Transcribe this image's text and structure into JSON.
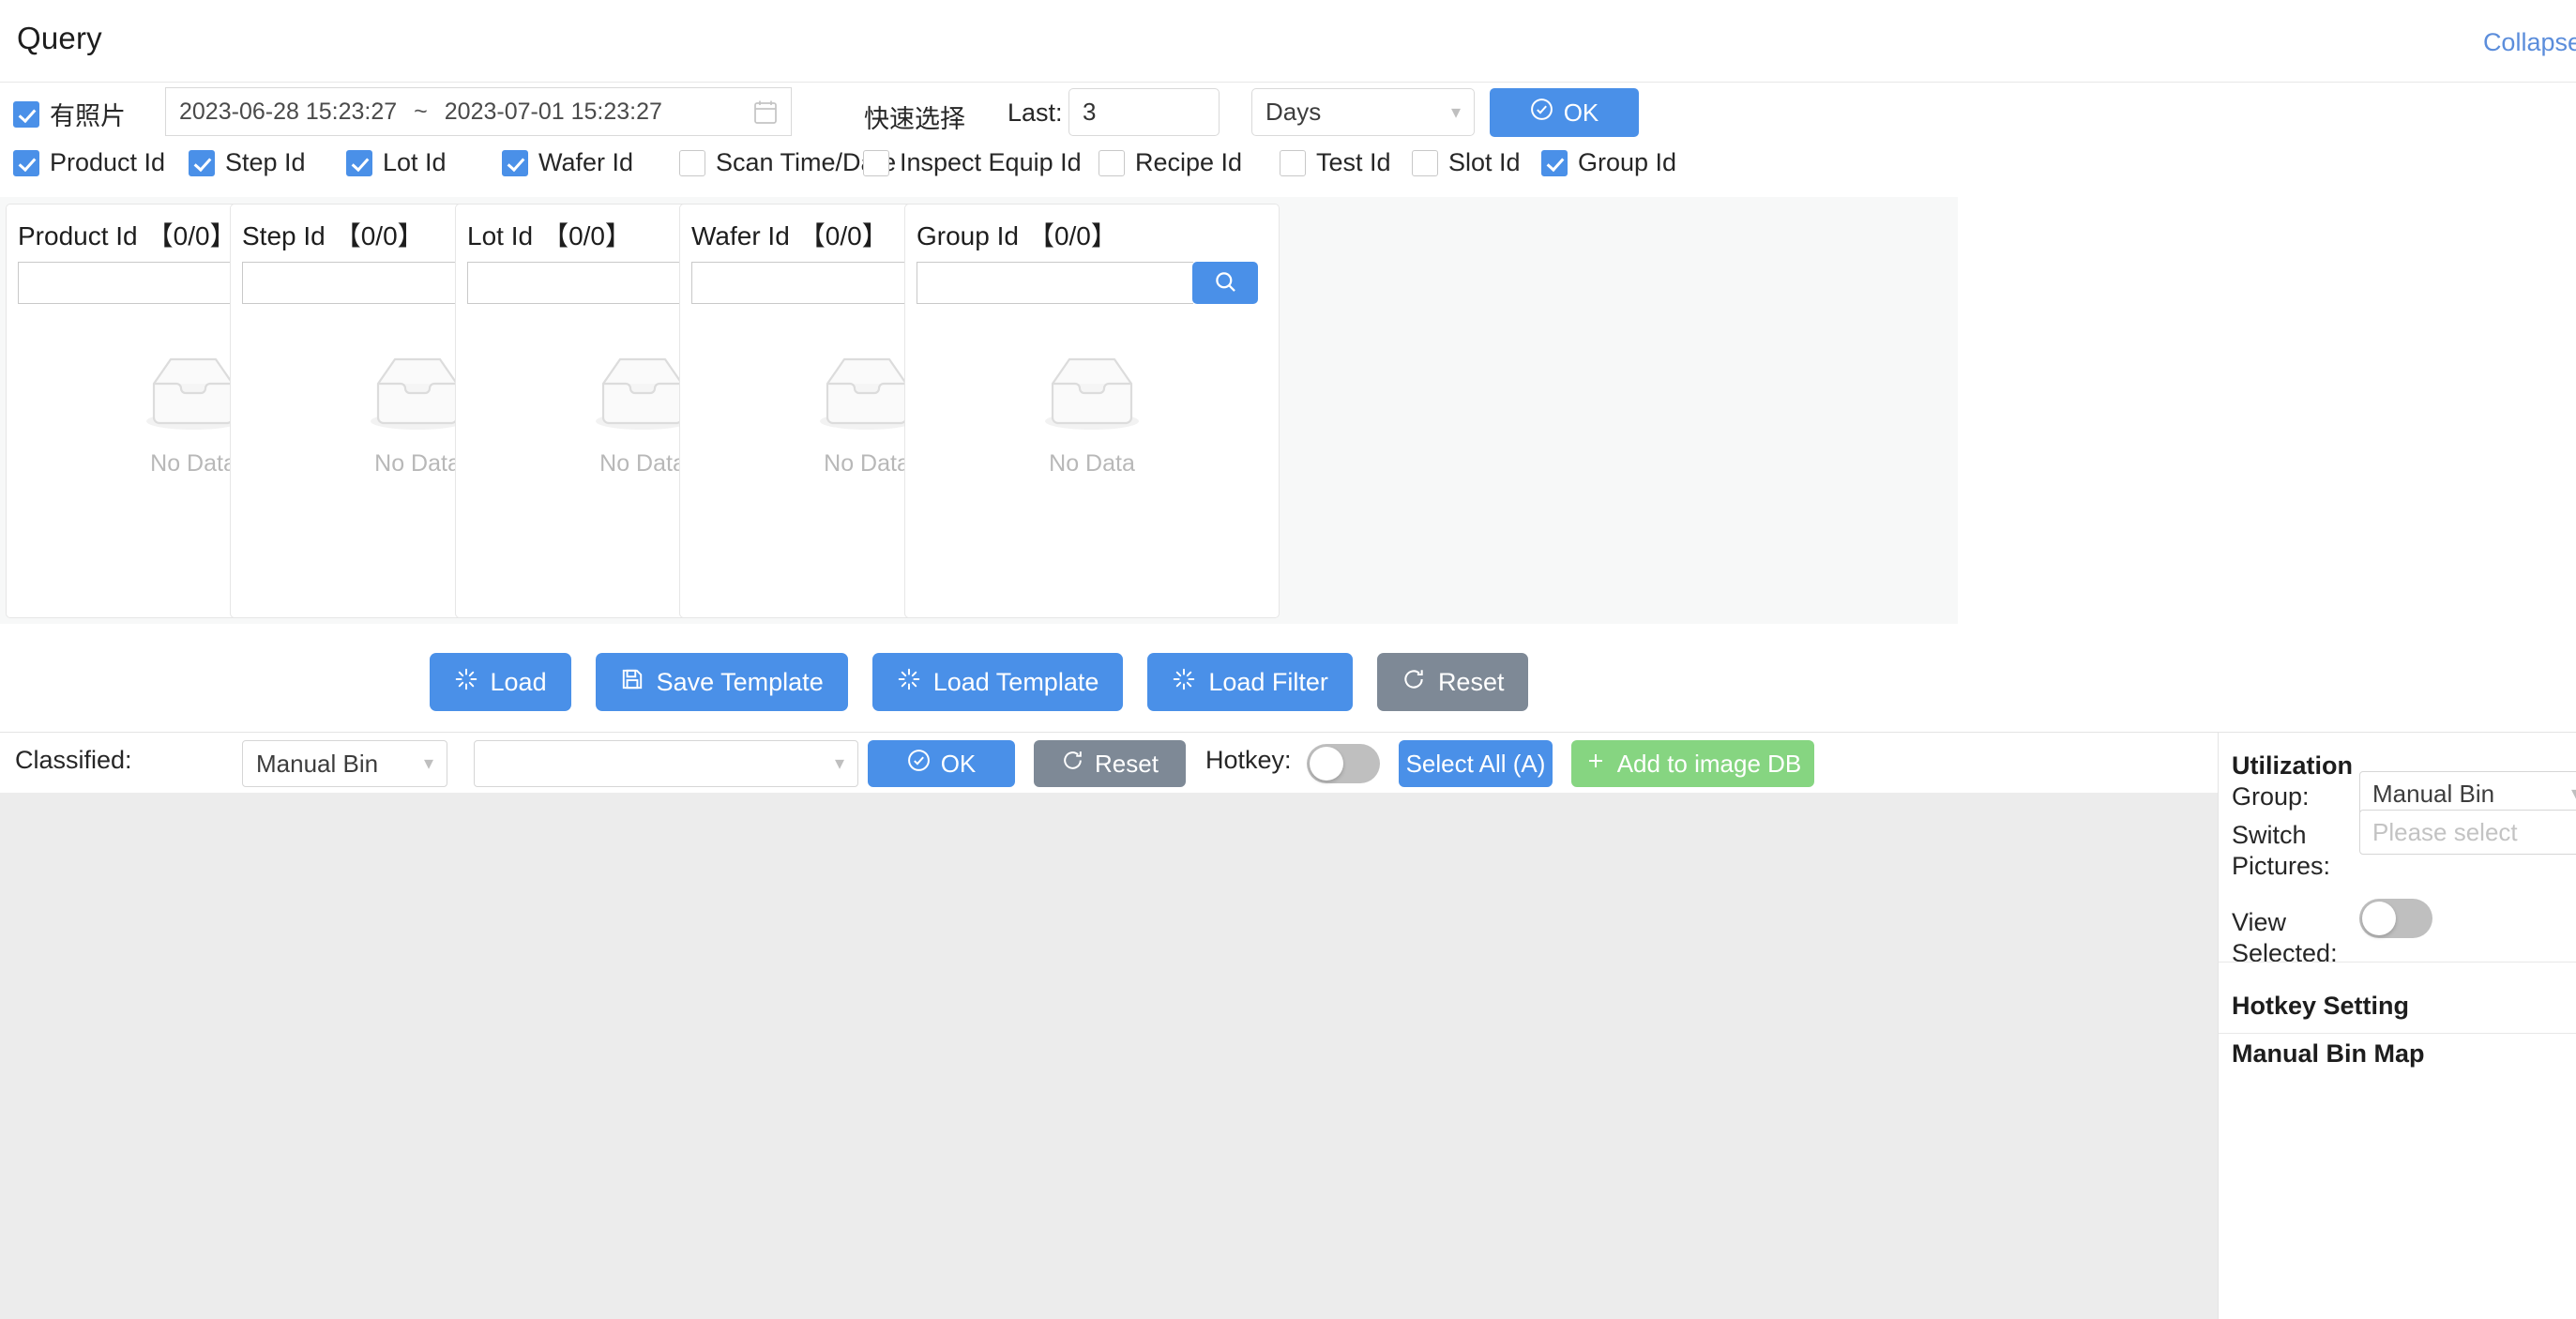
{
  "header": {
    "title": "Query",
    "collapse_label": "Collapse"
  },
  "query": {
    "has_photo": {
      "label": "有照片",
      "checked": true
    },
    "date_range": {
      "start": "2023-06-28 15:23:27",
      "separator": "~",
      "end": "2023-07-01 15:23:27"
    },
    "quick_select_label": "快速选择",
    "last_label": "Last:",
    "last_value": "3",
    "unit_value": "Days",
    "ok_label": "OK",
    "filters": [
      {
        "label": "Product Id",
        "checked": true
      },
      {
        "label": "Step Id",
        "checked": true
      },
      {
        "label": "Lot Id",
        "checked": true
      },
      {
        "label": "Wafer Id",
        "checked": true
      },
      {
        "label": "Scan Time/Date",
        "checked": false
      },
      {
        "label": "Inspect Equip Id",
        "checked": false
      },
      {
        "label": "Recipe Id",
        "checked": false
      },
      {
        "label": "Test Id",
        "checked": false
      },
      {
        "label": "Slot Id",
        "checked": false
      },
      {
        "label": "Group Id",
        "checked": true
      }
    ]
  },
  "cards": [
    {
      "title": "Product Id",
      "count": "【0/0】",
      "search_value": "",
      "empty_text": "No Data"
    },
    {
      "title": "Step Id",
      "count": "【0/0】",
      "search_value": "",
      "empty_text": "No Data"
    },
    {
      "title": "Lot Id",
      "count": "【0/0】",
      "search_value": "",
      "empty_text": "No Data"
    },
    {
      "title": "Wafer Id",
      "count": "【0/0】",
      "search_value": "",
      "empty_text": "No Data"
    },
    {
      "title": "Group Id",
      "count": "【0/0】",
      "search_value": "",
      "empty_text": "No Data"
    }
  ],
  "actions": [
    {
      "label": "Load",
      "icon": "spinner-icon"
    },
    {
      "label": "Save Template",
      "icon": "save-icon"
    },
    {
      "label": "Load Template",
      "icon": "spinner-icon"
    },
    {
      "label": "Load Filter",
      "icon": "spinner-icon"
    },
    {
      "label": "Reset",
      "icon": "refresh-icon"
    }
  ],
  "toolbar": {
    "classified_label": "Classified:",
    "type_value": "Manual Bin",
    "value_placeholder": "",
    "ok_label": "OK",
    "reset_label": "Reset",
    "hotkey_label": "Hotkey:",
    "hotkey_on": false,
    "select_all_label": "Select All (A)",
    "add_image_label": "Add to image DB"
  },
  "right_panel": {
    "utilization_title": "Utilization",
    "group_label": "Group:",
    "group_value": "Manual Bin",
    "switch_pictures_label": "Switch\nPictures:",
    "switch_pictures_line1": "Switch",
    "switch_pictures_line2": "Pictures:",
    "switch_pictures_placeholder": "Please select",
    "view_selected_line1": "View",
    "view_selected_line2": "Selected:",
    "view_selected_on": false,
    "hotkey_setting_title": "Hotkey Setting",
    "manual_bin_map_title": "Manual Bin Map"
  },
  "colors": {
    "primary": "#4a90e8",
    "grey_button": "#7e8996",
    "green_button": "#86d581",
    "link": "#5b8ddb",
    "card_area_bg": "#f7f8f8",
    "main_bg": "#ececec"
  }
}
